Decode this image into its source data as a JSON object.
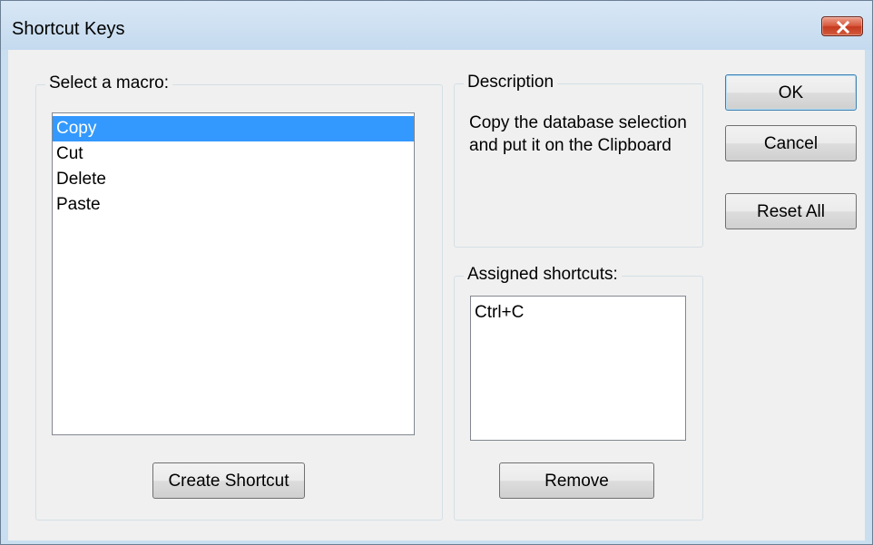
{
  "window": {
    "title": "Shortcut Keys",
    "close_icon": "close-icon"
  },
  "macro_group": {
    "label": "Select a macro:",
    "items": [
      {
        "label": "Copy",
        "selected": true
      },
      {
        "label": "Cut",
        "selected": false
      },
      {
        "label": "Delete",
        "selected": false
      },
      {
        "label": "Paste",
        "selected": false
      }
    ],
    "create_label": "Create Shortcut"
  },
  "description_group": {
    "label": "Description",
    "text": "Copy the database selection and put it on the Clipboard"
  },
  "shortcuts_group": {
    "label": "Assigned shortcuts:",
    "items": [
      {
        "label": "Ctrl+C"
      }
    ],
    "remove_label": "Remove"
  },
  "buttons": {
    "ok": "OK",
    "cancel": "Cancel",
    "reset_all": "Reset All"
  },
  "colors": {
    "selection": "#3399ff",
    "title_bar": "#c9dff0",
    "close_button": "#c53a1f"
  }
}
